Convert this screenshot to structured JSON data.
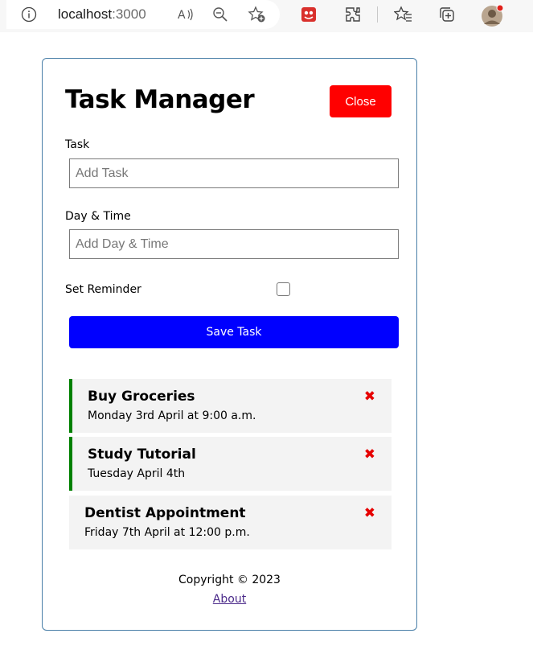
{
  "browser": {
    "url_host": "localhost",
    "url_port": ":3000"
  },
  "header": {
    "title": "Task Manager",
    "close_label": "Close"
  },
  "form": {
    "task_label": "Task",
    "task_placeholder": "Add Task",
    "task_value": "",
    "day_label": "Day & Time",
    "day_placeholder": "Add Day & Time",
    "day_value": "",
    "reminder_label": "Set Reminder",
    "reminder_checked": false,
    "save_label": "Save Task"
  },
  "tasks": [
    {
      "text": "Buy Groceries",
      "day": "Monday 3rd April at 9:00 a.m.",
      "reminder": true
    },
    {
      "text": "Study Tutorial",
      "day": "Tuesday April 4th",
      "reminder": true
    },
    {
      "text": "Dentist Appointment",
      "day": "Friday 7th April at 12:00 p.m.",
      "reminder": false
    }
  ],
  "footer": {
    "copyright": "Copyright © 2023",
    "about_label": "About"
  },
  "colors": {
    "close_button": "#ff0000",
    "save_button": "#0000ff",
    "reminder_border": "#008000",
    "delete_icon": "#e60000"
  }
}
